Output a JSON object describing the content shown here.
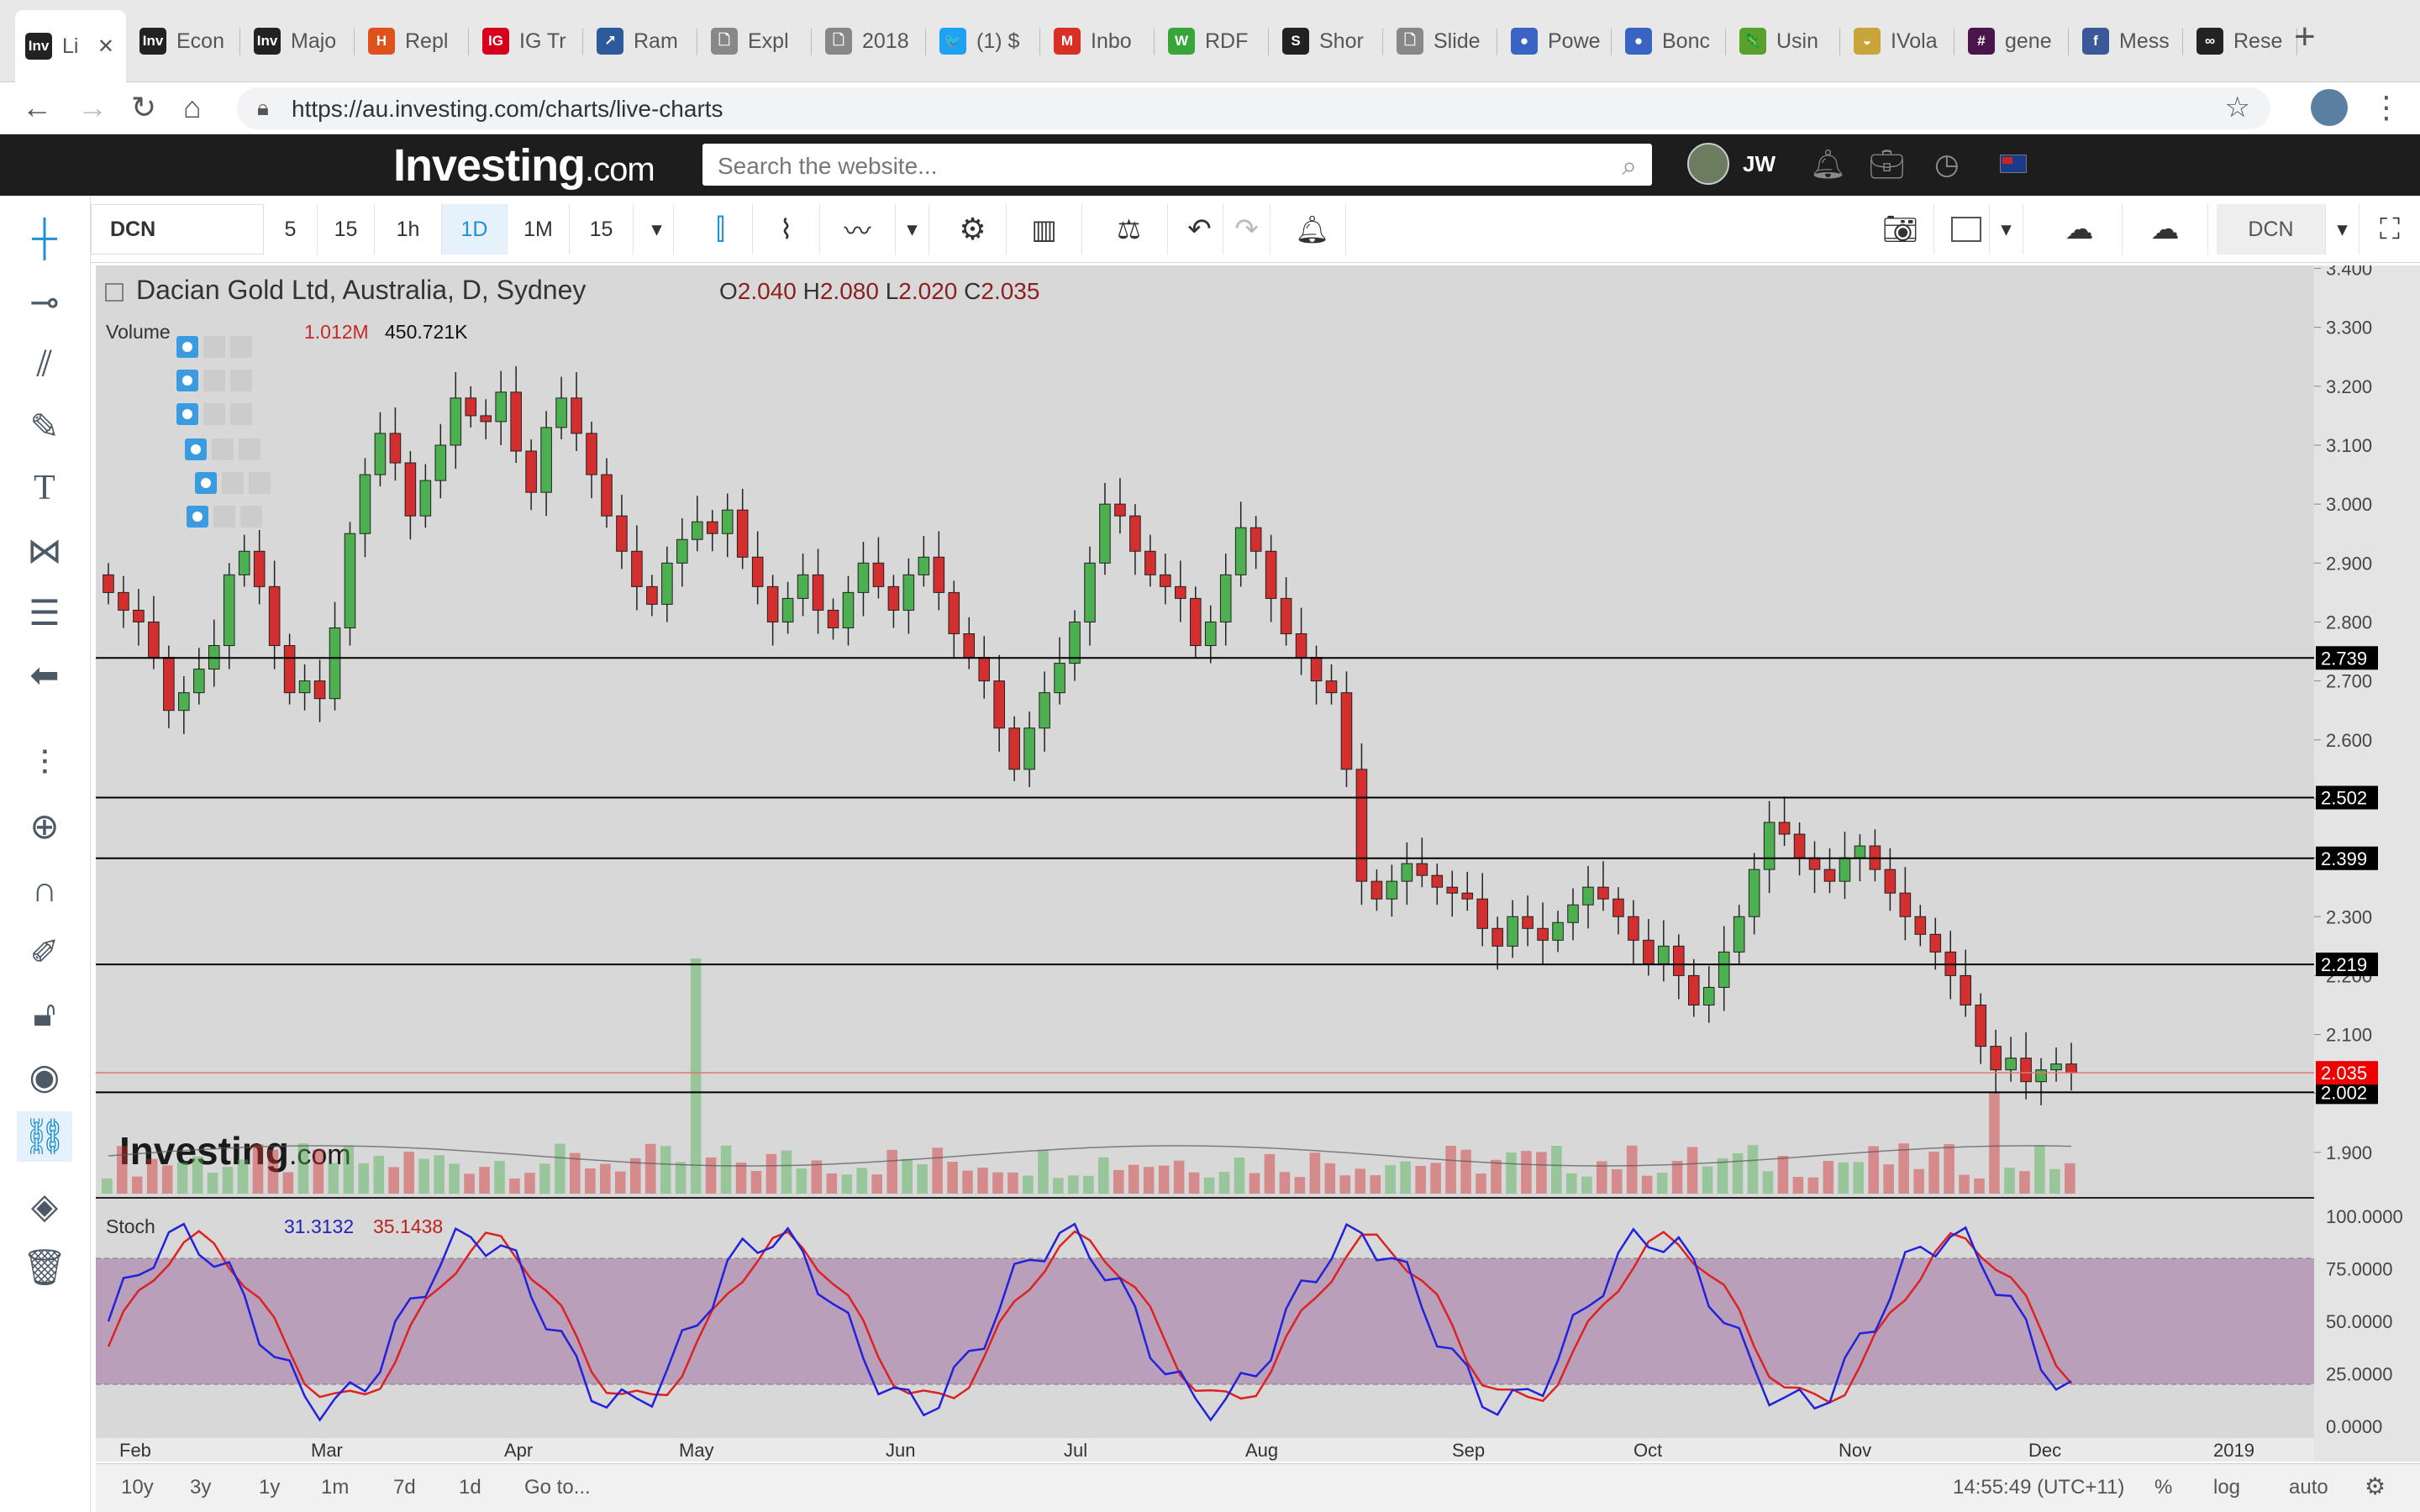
{
  "browser": {
    "tabs": [
      {
        "label": "Li",
        "fav": "Inv",
        "color": "#222222",
        "active": true
      },
      {
        "label": "Econ",
        "fav": "Inv",
        "color": "#222222"
      },
      {
        "label": "Majo",
        "fav": "Inv",
        "color": "#222222"
      },
      {
        "label": "Repl",
        "fav": "H",
        "color": "#e0521b"
      },
      {
        "label": "IG Tr",
        "fav": "IG",
        "color": "#d6001c"
      },
      {
        "label": "Ram",
        "fav": "↗",
        "color": "#2d5a9a"
      },
      {
        "label": "Expl",
        "fav": "🗋",
        "color": "#888888"
      },
      {
        "label": "2018",
        "fav": "🗋",
        "color": "#888888"
      },
      {
        "label": "(1) $",
        "fav": "🐦",
        "color": "#1da1f2"
      },
      {
        "label": "Inbo",
        "fav": "M",
        "color": "#d93025"
      },
      {
        "label": "RDF",
        "fav": "W",
        "color": "#38a538"
      },
      {
        "label": "Shor",
        "fav": "S",
        "color": "#222222"
      },
      {
        "label": "Slide",
        "fav": "🗋",
        "color": "#888888"
      },
      {
        "label": "Powe",
        "fav": "●",
        "color": "#3a64c4"
      },
      {
        "label": "Bonc",
        "fav": "●",
        "color": "#3a64c4"
      },
      {
        "label": "Usin",
        "fav": "🦎",
        "color": "#5aa02c"
      },
      {
        "label": "IVola",
        "fav": "◒",
        "color": "#c9a43a"
      },
      {
        "label": "gene",
        "fav": "#",
        "color": "#4a154b"
      },
      {
        "label": "Mess",
        "fav": "f",
        "color": "#3b5998"
      },
      {
        "label": "Rese",
        "fav": "∞",
        "color": "#222222"
      }
    ],
    "url": "https://au.investing.com/charts/live-charts",
    "close_glyph": "✕",
    "new_tab_glyph": "+"
  },
  "site": {
    "logo_main": "Investing",
    "logo_suffix": ".com",
    "search_placeholder": "Search the website...",
    "user_initials": "JW"
  },
  "toolbar": {
    "symbol": "DCN",
    "intervals": [
      "5",
      "15",
      "1h",
      "1D",
      "1M",
      "15"
    ],
    "active_interval": "1D",
    "symbol_right": "DCN"
  },
  "legend": {
    "title": "Dacian Gold Ltd, Australia, D, Sydney",
    "o_label": "O",
    "o": "2.040",
    "h_label": "H",
    "h": "2.080",
    "l_label": "L",
    "l": "2.020",
    "c_label": "C",
    "c": "2.035",
    "volume_label": "Volume",
    "volume_1": "1.012M",
    "volume_2": "450.721K",
    "stoch_label": "Stoch",
    "stoch_k": "31.3132",
    "stoch_d": "35.1438"
  },
  "watermark": {
    "main": "Investing",
    "suffix": ".com"
  },
  "bottom": {
    "ranges": [
      "10y",
      "3y",
      "1y",
      "1m",
      "7d",
      "1d"
    ],
    "goto": "Go to...",
    "time": "14:55:49 (UTC+11)",
    "pct": "%",
    "log": "log",
    "auto": "auto"
  },
  "colors": {
    "up": "#4caf50",
    "down": "#d32f2f",
    "stoch_k": "#2222dd",
    "stoch_d": "#dd2222",
    "stoch_band": "#b595b5",
    "chart_bg": "#d8d8d8"
  },
  "chart_data": {
    "type": "candlestick",
    "title": "Dacian Gold Ltd, Australia, D, Sydney",
    "price_axis_ticks": [
      "3.400",
      "3.300",
      "3.200",
      "3.100",
      "3.000",
      "2.900",
      "2.800",
      "2.700",
      "2.600",
      "2.500",
      "2.400",
      "2.300",
      "2.200",
      "2.100",
      "2.000",
      "1.900"
    ],
    "ylim": [
      1.83,
      3.405
    ],
    "x_month_labels": [
      "Feb",
      "Mar",
      "Apr",
      "May",
      "Jun",
      "Jul",
      "Aug",
      "Sep",
      "Oct",
      "Nov",
      "Dec",
      "2019"
    ],
    "support_resistance_levels": [
      2.739,
      2.502,
      2.399,
      2.219,
      2.002
    ],
    "level_labels": [
      "2.739",
      "2.502",
      "2.399",
      "2.219",
      "2.002"
    ],
    "last_price": 2.035,
    "last_price_label": "2.035",
    "close_series": [
      2.85,
      2.82,
      2.8,
      2.74,
      2.65,
      2.68,
      2.72,
      2.76,
      2.88,
      2.92,
      2.86,
      2.76,
      2.68,
      2.7,
      2.67,
      2.79,
      2.95,
      3.05,
      3.12,
      3.07,
      2.98,
      3.04,
      3.1,
      3.18,
      3.15,
      3.14,
      3.19,
      3.09,
      3.02,
      3.13,
      3.18,
      3.12,
      3.05,
      2.98,
      2.92,
      2.86,
      2.83,
      2.9,
      2.94,
      2.97,
      2.95,
      2.99,
      2.91,
      2.86,
      2.8,
      2.84,
      2.88,
      2.82,
      2.79,
      2.85,
      2.9,
      2.86,
      2.82,
      2.88,
      2.91,
      2.85,
      2.78,
      2.74,
      2.7,
      2.62,
      2.55,
      2.62,
      2.68,
      2.73,
      2.8,
      2.9,
      3.0,
      2.98,
      2.92,
      2.88,
      2.86,
      2.84,
      2.76,
      2.8,
      2.88,
      2.96,
      2.92,
      2.84,
      2.78,
      2.74,
      2.7,
      2.68,
      2.55,
      2.36,
      2.33,
      2.36,
      2.39,
      2.37,
      2.35,
      2.34,
      2.33,
      2.28,
      2.25,
      2.3,
      2.28,
      2.26,
      2.29,
      2.32,
      2.35,
      2.33,
      2.3,
      2.26,
      2.22,
      2.25,
      2.2,
      2.15,
      2.18,
      2.24,
      2.3,
      2.38,
      2.46,
      2.44,
      2.4,
      2.38,
      2.36,
      2.4,
      2.42,
      2.38,
      2.34,
      2.3,
      2.27,
      2.24,
      2.2,
      2.15,
      2.08,
      2.04,
      2.06,
      2.02,
      2.04,
      2.05,
      2.035
    ],
    "stoch_axis_ticks": [
      "100.0000",
      "75.0000",
      "50.0000",
      "25.0000",
      "0.0000"
    ],
    "stoch_overbought": 80,
    "stoch_oversold": 20,
    "stoch_k_last": 31.3132,
    "stoch_d_last": 35.1438
  }
}
